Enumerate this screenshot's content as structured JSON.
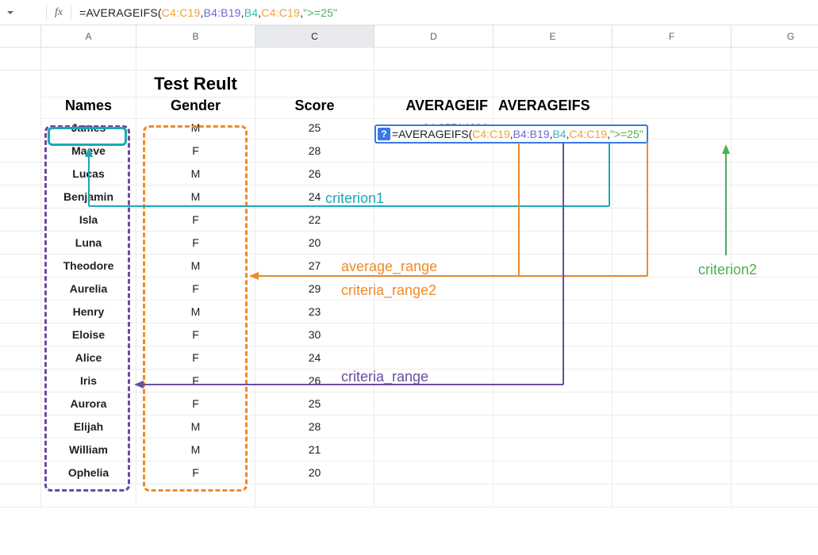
{
  "fxbar": {
    "fx_label": "fx",
    "fn": "=AVERAGEIFS(",
    "r1": "C4:C19",
    "r2": "B4:B19",
    "r3": "B4",
    "r4": "C4:C19",
    "str": "\">=25\"",
    "close": ""
  },
  "columns": [
    "",
    "A",
    "B",
    "C",
    "D",
    "E",
    "F",
    "G"
  ],
  "selected_col": "C",
  "title": "Test Reult",
  "headers": {
    "names": "Names",
    "gender": "Gender",
    "score": "Score",
    "avgif": "AVERAGEIF",
    "avgifs": "AVERAGEIFS"
  },
  "rows": [
    {
      "name": "James",
      "gender": "M",
      "score": 25
    },
    {
      "name": "Maeve",
      "gender": "F",
      "score": 28
    },
    {
      "name": "Lucas",
      "gender": "M",
      "score": 26
    },
    {
      "name": "Benjamin",
      "gender": "M",
      "score": 24
    },
    {
      "name": "Isla",
      "gender": "F",
      "score": 22
    },
    {
      "name": "Luna",
      "gender": "F",
      "score": 20
    },
    {
      "name": "Theodore",
      "gender": "M",
      "score": 27
    },
    {
      "name": "Aurelia",
      "gender": "F",
      "score": 29
    },
    {
      "name": "Henry",
      "gender": "M",
      "score": 23
    },
    {
      "name": "Eloise",
      "gender": "F",
      "score": 30
    },
    {
      "name": "Alice",
      "gender": "F",
      "score": 24
    },
    {
      "name": "Iris",
      "gender": "F",
      "score": 26
    },
    {
      "name": "Aurora",
      "gender": "F",
      "score": 25
    },
    {
      "name": "Elijah",
      "gender": "M",
      "score": 28
    },
    {
      "name": "William",
      "gender": "M",
      "score": 21
    },
    {
      "name": "Ophelia",
      "gender": "F",
      "score": 20
    }
  ],
  "result_avgif": "24.85714286",
  "overlay_formula": {
    "q": "?",
    "fn": "=AVERAGEIFS(",
    "r1": "C4:C19",
    "r2": "B4:B19",
    "r3": "B4",
    "r4": "C4:C19",
    "str": "\">=25\"",
    "close": ""
  },
  "ann": {
    "criterion1": "criterion1",
    "average_range": "average_range",
    "criteria_range2": "criteria_range2",
    "criteria_range": "criteria_range",
    "criterion2": "criterion2"
  },
  "colors": {
    "teal": "#1ea7b5",
    "orange": "#ed8a2b",
    "purple": "#6b4ba1",
    "green": "#4caf50"
  }
}
